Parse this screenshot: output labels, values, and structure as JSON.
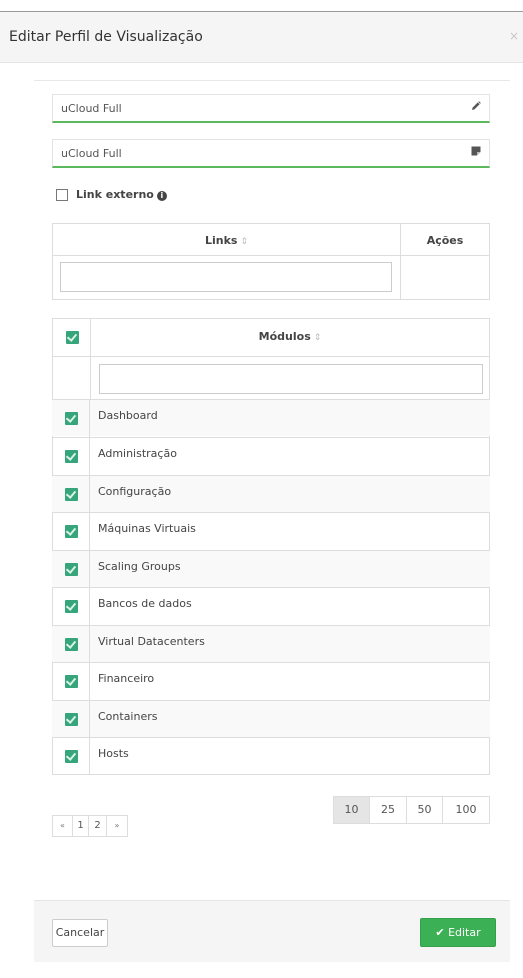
{
  "modal": {
    "title": "Editar Perfil de Visualização",
    "close": "×"
  },
  "fields": [
    {
      "value": "uCloud Full",
      "icon": "pencil-icon"
    },
    {
      "value": "uCloud Full",
      "icon": "note-icon"
    }
  ],
  "external_link": {
    "label": "Link externo",
    "info_icon": "i",
    "checked": false
  },
  "links_table": {
    "header_links": "Links",
    "header_actions": "Ações",
    "sort_icon": "⇕"
  },
  "modules_table": {
    "header": "Módulos",
    "sort_icon": "⇕",
    "items": [
      {
        "label": "Dashboard",
        "checked": true
      },
      {
        "label": "Administração",
        "checked": true
      },
      {
        "label": "Configuração",
        "checked": true
      },
      {
        "label": "Máquinas Virtuais",
        "checked": true
      },
      {
        "label": "Scaling Groups",
        "checked": true
      },
      {
        "label": "Bancos de dados",
        "checked": true
      },
      {
        "label": "Virtual Datacenters",
        "checked": true
      },
      {
        "label": "Financeiro",
        "checked": true
      },
      {
        "label": "Containers",
        "checked": true
      },
      {
        "label": "Hosts",
        "checked": true
      }
    ]
  },
  "pagination": {
    "first": "«",
    "pages": [
      "1",
      "2"
    ],
    "last": "»"
  },
  "page_sizes": {
    "options": [
      "10",
      "25",
      "50",
      "100"
    ],
    "selected": "10"
  },
  "footer": {
    "cancel": "Cancelar",
    "edit": "Editar"
  },
  "colors": {
    "accent_green": "#3cb054",
    "checkbox_green": "#37a57b",
    "field_underline": "#5cb85c"
  }
}
